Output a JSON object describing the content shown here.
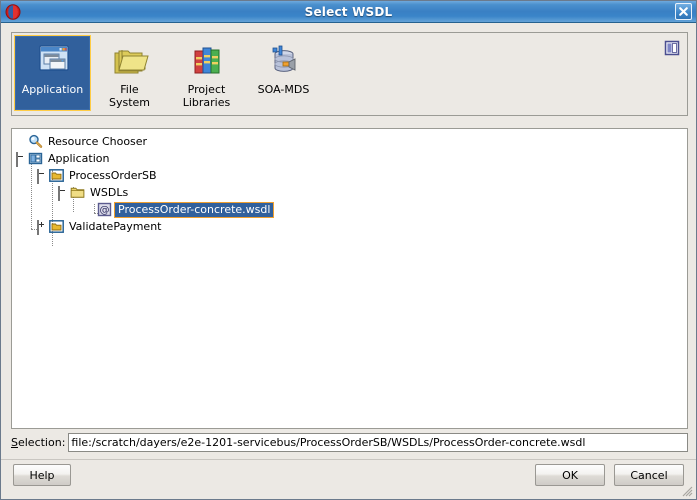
{
  "window": {
    "title": "Select WSDL",
    "logo_icon": "oracle-logo-icon",
    "close_icon": "close-icon"
  },
  "source_bar": {
    "items": [
      {
        "label": "Application",
        "icon": "application-windows-icon",
        "selected": true
      },
      {
        "label": "File\nSystem",
        "icon": "folder-icon",
        "selected": false
      },
      {
        "label": "Project\nLibraries",
        "icon": "books-icon",
        "selected": false
      },
      {
        "label": "SOA-MDS",
        "icon": "database-icon",
        "selected": false
      }
    ],
    "panel_toggle_icon": "panel-layout-icon"
  },
  "tree": {
    "nodes": [
      {
        "label": "Resource Chooser",
        "icon": "magnifier-icon",
        "indent": 0,
        "handle": "none",
        "selected": false
      },
      {
        "label": "Application",
        "icon": "application-node-icon",
        "indent": 1,
        "handle": "minus",
        "selected": false
      },
      {
        "label": "ProcessOrderSB",
        "icon": "project-folder-icon",
        "indent": 2,
        "handle": "minus",
        "selected": false
      },
      {
        "label": "WSDLs",
        "icon": "folder-icon",
        "indent": 3,
        "handle": "minus",
        "selected": false
      },
      {
        "label": "ProcessOrder-concrete.wsdl",
        "icon": "wsdl-at-icon",
        "indent": 4,
        "handle": "none",
        "selected": true
      },
      {
        "label": "ValidatePayment",
        "icon": "project-folder-icon",
        "indent": 2,
        "handle": "plus",
        "selected": false
      }
    ]
  },
  "selection": {
    "label": "Selection:",
    "value": "file:/scratch/dayers/e2e-1201-servicebus/ProcessOrderSB/WSDLs/ProcessOrder-concrete.wsdl",
    "placeholder": ""
  },
  "buttons": {
    "help": "Help",
    "ok": "OK",
    "cancel": "Cancel"
  },
  "colors": {
    "titlebar_blue": "#3a80c4",
    "selected_blue": "#31609c",
    "selection_border": "#f0a030",
    "dialog_bg": "#ece9e4"
  }
}
